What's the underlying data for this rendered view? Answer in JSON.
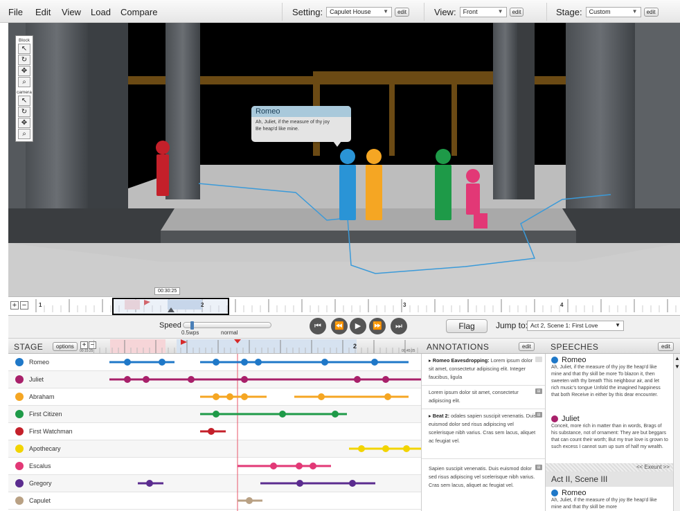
{
  "menu": {
    "items": [
      "File",
      "Edit",
      "View",
      "Load",
      "Compare"
    ],
    "setting_label": "Setting:",
    "setting_value": "Capulet House",
    "view_label": "View:",
    "view_value": "Front",
    "stage_label": "Stage:",
    "stage_value": "Custom",
    "edit_label": "edit"
  },
  "palette": {
    "block_label": "Block",
    "camera_label": "camera"
  },
  "bubble": {
    "name": "Romeo",
    "line1": "Ah, Juliet, if the measure of thy joy",
    "line2": "Be heap'd like mine."
  },
  "timeline": {
    "timecode": "00:30:25",
    "ticks": [
      "1",
      "2",
      "3",
      "4"
    ]
  },
  "playback": {
    "speed_label": "Speed",
    "speed_value": "0.5wps",
    "speed_normal": "normal",
    "flag_label": "Flag",
    "jump_label": "Jump to:",
    "jump_value": "Act 2, Scene 1: First Love"
  },
  "stage_panel": {
    "title": "STAGE",
    "options_label": "options",
    "time_start": "00:15:25",
    "time_end": "00:45:25",
    "characters": [
      {
        "name": "Romeo",
        "color": "#1f78c8"
      },
      {
        "name": "Juliet",
        "color": "#a8206a"
      },
      {
        "name": "Abraham",
        "color": "#f5a623"
      },
      {
        "name": "First Citizen",
        "color": "#1e9a48"
      },
      {
        "name": "First Watchman",
        "color": "#c4202a"
      },
      {
        "name": "Apothecary",
        "color": "#f2d400"
      },
      {
        "name": "Escalus",
        "color": "#e23876"
      },
      {
        "name": "Gregory",
        "color": "#5b2c8f"
      },
      {
        "name": "Capulet",
        "color": "#b9a184"
      }
    ]
  },
  "annotations": {
    "title": "ANNOTATIONS",
    "edit_label": "edit",
    "items": [
      {
        "title": "Romeo Eavesdropping:",
        "text": "Lorem ipsum dolor sit amet, consectetur adipiscing elit. Integer faucibus, ligula"
      },
      {
        "title": "",
        "text": "Lorem ipsum dolor sit amet, consectetur adipiscing elit."
      },
      {
        "title": "Beat 2:",
        "text": "odales sapien suscipit venenatis. Duis euismod dolor sed risus adipiscing vel scelerisque nibh varius. Cras sem lacus, aliquet ac feugiat vel."
      },
      {
        "title": "",
        "text": "Sapien suscipit venenatis. Duis euismod dolor sed risus adipiscing vel scelerisque nibh varius. Cras sem lacus, aliquet ac feugiat vel."
      }
    ]
  },
  "speeches": {
    "title": "SPEECHES",
    "edit_label": "edit",
    "romeo_name": "Romeo",
    "romeo_text": "Ah, Juliet, if the measure of thy joy Be heap'd like mine and that thy skill be more To blazon it, then sweeten with thy breath This neighbour air, and let rich music's tongue Unfold the imagined happiness that both Receive in either by this dear encounter.",
    "juliet_name": "Juliet",
    "juliet_text": "Conceit, more rich in matter than in words, Brags of his substance, not of ornament: They are but beggars that can count their worth; But my true love is grown to such excess I cannot sum up sum of half my wealth.",
    "exeunt": "<< Exeunt >>",
    "scene_title": "Act II, Scene III",
    "romeo2_name": "Romeo",
    "romeo2_text": "Ah, Juliet, if the measure of thy joy Be heap'd like mine and that thy skill be more"
  }
}
